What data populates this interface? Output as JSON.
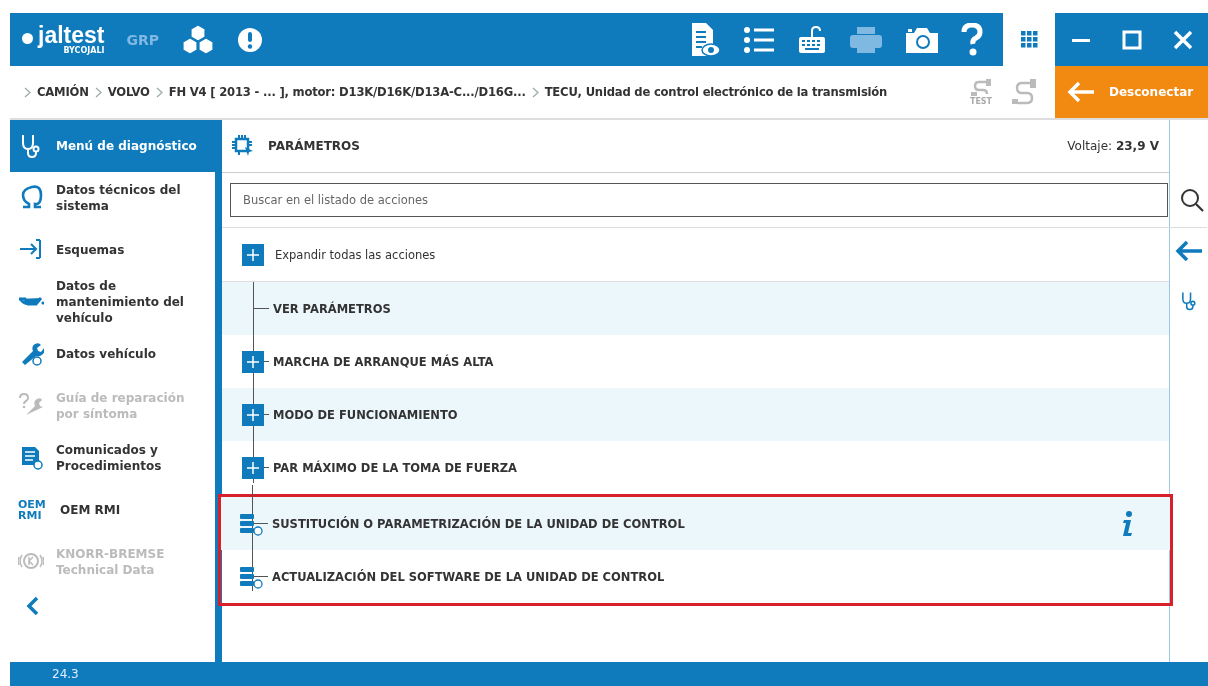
{
  "topbar": {
    "logo": "jaltest",
    "logo_sub": "BYCOJALI",
    "mode": "GRP",
    "version_grid_active": true
  },
  "breadcrumb": [
    "CAMIÓN",
    "VOLVO",
    "FH V4 [ 2013 - ... ], motor: D13K/D16K/D13A-C.../D16G...",
    "TECU, Unidad de control electrónico de la transmisión"
  ],
  "test_label": "TEST",
  "disconnect": "Desconectar",
  "sidebar": {
    "items": [
      {
        "kind": "header",
        "label": "Menú de diagnóstico",
        "selected": true,
        "disabled": false
      },
      {
        "kind": "omega",
        "label": "Datos técnicos del sistema",
        "selected": false,
        "disabled": false
      },
      {
        "kind": "schema",
        "label": "Esquemas",
        "selected": false,
        "disabled": false
      },
      {
        "kind": "oil",
        "label": "Datos de mantenimiento del vehículo",
        "selected": false,
        "disabled": false
      },
      {
        "kind": "wrench",
        "label": "Datos vehículo",
        "selected": false,
        "disabled": false
      },
      {
        "kind": "repair",
        "label": "Guía de reparación por síntoma",
        "selected": false,
        "disabled": true
      },
      {
        "kind": "doc",
        "label": "Comunicados y Procedimientos",
        "selected": false,
        "disabled": false
      },
      {
        "kind": "oem",
        "label": "OEM RMI",
        "badge": "OEM",
        "badge2": "RMI",
        "selected": false,
        "disabled": false
      },
      {
        "kind": "knorr",
        "label": "KNORR-BREMSE Technical Data",
        "selected": false,
        "disabled": true
      }
    ]
  },
  "panel": {
    "title": "PARÁMETROS",
    "voltage_label": "Voltaje:",
    "voltage": "23,9 V"
  },
  "search": {
    "placeholder": "Buscar en el listado de acciones"
  },
  "expand_all": "Expandir todas las acciones",
  "actions": [
    {
      "kind": "leaf",
      "label": "VER PARÁMETROS",
      "highlighted": false,
      "info": false
    },
    {
      "kind": "expand",
      "label": "MARCHA DE ARRANQUE MÁS ALTA",
      "highlighted": false,
      "info": false
    },
    {
      "kind": "expand",
      "label": "MODO DE FUNCIONAMIENTO",
      "highlighted": false,
      "info": false
    },
    {
      "kind": "expand",
      "label": "PAR MÁXIMO DE LA TOMA DE FUERZA",
      "highlighted": false,
      "info": false
    },
    {
      "kind": "procedure",
      "label": "SUSTITUCIÓN O PARAMETRIZACIÓN DE LA UNIDAD DE CONTROL",
      "highlighted": true,
      "info": true
    },
    {
      "kind": "procedure",
      "label": "ACTUALIZACIÓN DEL SOFTWARE DE LA UNIDAD DE CONTROL",
      "highlighted": true,
      "info": false
    }
  ],
  "footer": {
    "version": "24.3"
  }
}
